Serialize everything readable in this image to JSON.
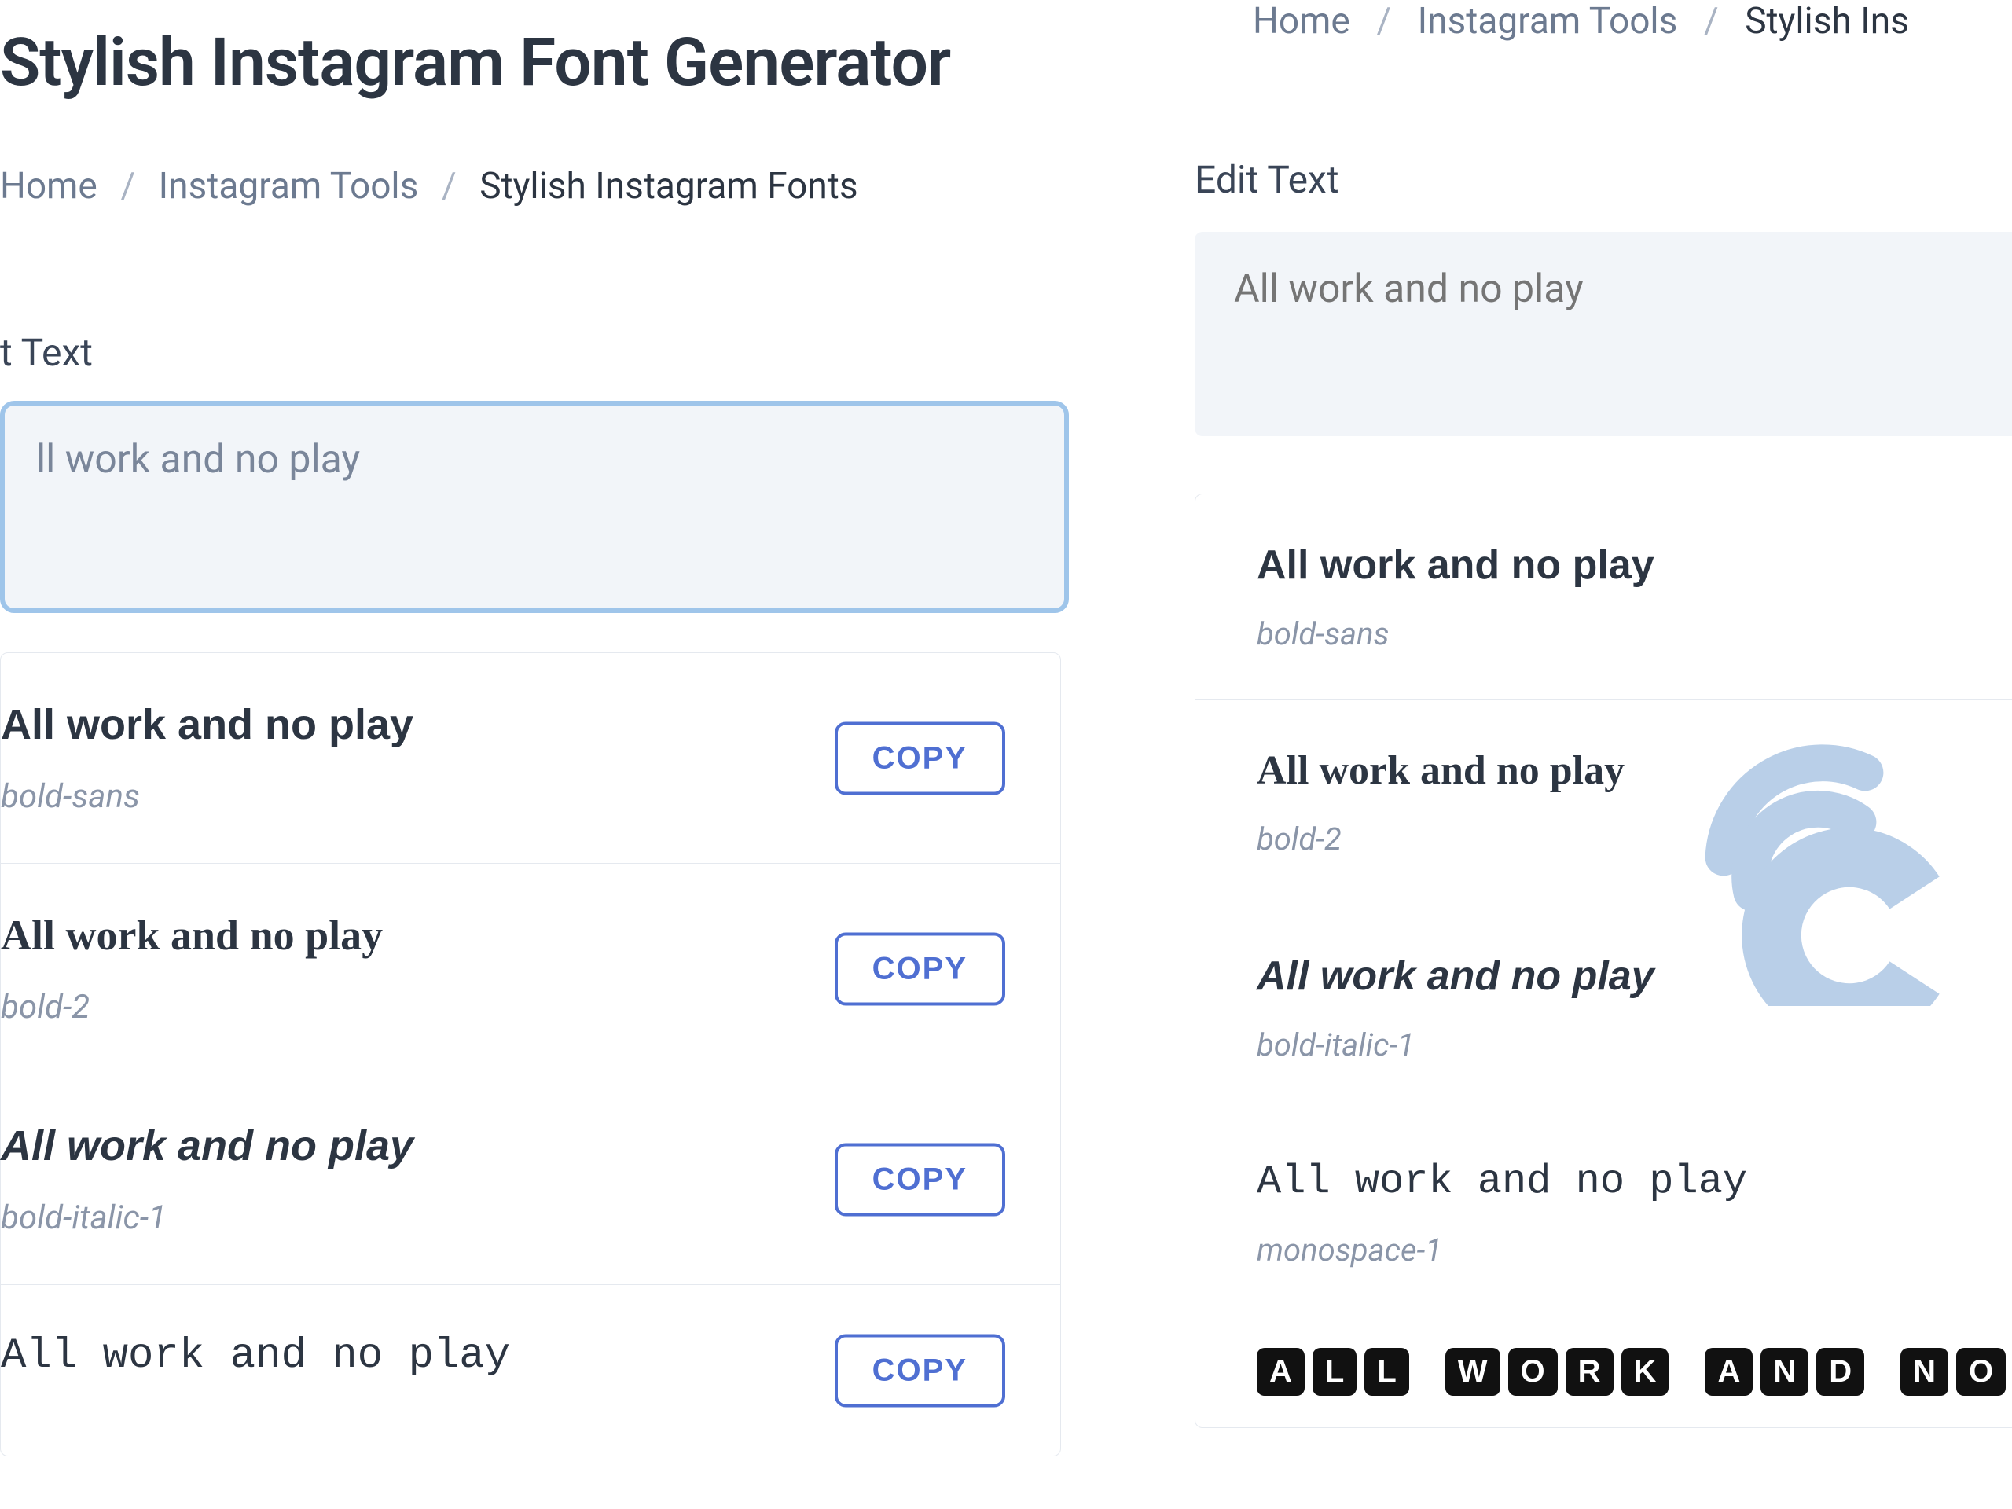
{
  "page_title": "Stylish Instagram Font Generator",
  "breadcrumb": {
    "home": "Home",
    "tools": "Instagram Tools",
    "current": "Stylish Instagram Fonts",
    "current_cut": "Stylish Ins"
  },
  "edit_section": {
    "label": "Edit Text",
    "label_cut": "t Text",
    "placeholder": "All work and no play",
    "placeholder_cut": "ll work and no play"
  },
  "copy_label": "COPY",
  "variants_left": [
    {
      "text": "All work and no play",
      "tag": "bold-sans",
      "klass": "f-bold-sans"
    },
    {
      "text": "All work and no play",
      "tag": "bold-2",
      "klass": "f-bold-serif"
    },
    {
      "text": "All work and no play",
      "tag": "bold-italic-1",
      "klass": "f-bold-italic"
    },
    {
      "text": "All work and no play",
      "tag": "",
      "klass": "f-mono"
    }
  ],
  "variants_right": [
    {
      "text": "All work and no play",
      "tag": "bold-sans",
      "klass": "f-bold-sans"
    },
    {
      "text": "All work and no play",
      "tag": "bold-2",
      "klass": "f-bold-serif"
    },
    {
      "text": "All work and no play",
      "tag": "bold-italic-1",
      "klass": "f-bold-italic"
    },
    {
      "text": "All work and no play",
      "tag": "monospace-1",
      "klass": "f-mono"
    }
  ],
  "boxed_text": "ALL WORK AND NO PL"
}
